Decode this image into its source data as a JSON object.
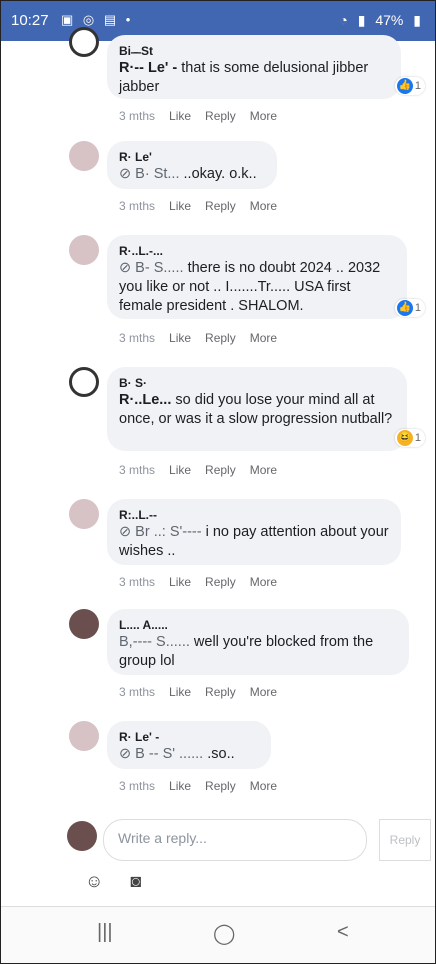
{
  "status_bar": {
    "time": "10:27",
    "left_icons": "▣ ◎ ▤ •",
    "battery": "47%"
  },
  "comments": [
    {
      "name": "Bi ̶  ̶ St",
      "mention": "R·-- Le' -",
      "text": "that is some delusional jibber jabber",
      "time": "3 mths",
      "like": "Like",
      "reply": "Reply",
      "more": "More",
      "reaction": "like",
      "reaction_count": "1"
    },
    {
      "name": "R· Le' ",
      "reply_to": "⊘ B·  St...",
      "text": "..okay. o.k..",
      "time": "3 mths",
      "like": "Like",
      "reply": "Reply",
      "more": "More"
    },
    {
      "name": "R·..L.-...",
      "reply_to": "⊘ B-  S.....",
      "text": "there is no doubt 2024 .. 2032 you like or not .. I.......Tr..... USA first female president . SHALOM.",
      "time": "3 mths",
      "like": "Like",
      "reply": "Reply",
      "more": "More",
      "reaction": "like",
      "reaction_count": "1"
    },
    {
      "name": "B·  S·",
      "mention": "R·..Le...",
      "text": "so did you lose your mind all at once, or was it a slow progression nutball?",
      "time": "3 mths",
      "like": "Like",
      "reply": "Reply",
      "more": "More",
      "reaction": "haha",
      "reaction_count": "1"
    },
    {
      "name": "R:..L.--",
      "reply_to": "⊘ Br ..: S'----",
      "text": "i no pay attention about your wishes ..",
      "time": "3 mths",
      "like": "Like",
      "reply": "Reply",
      "more": "More"
    },
    {
      "name": "L.... A.....",
      "reply_to": "B,---- S......",
      "text": "well you're blocked from the group lol",
      "time": "3 mths",
      "like": "Like",
      "reply": "Reply",
      "more": "More"
    },
    {
      "name": "R· Le' -",
      "reply_to": "⊘ B  -- S' ......",
      "text": ".so..",
      "time": "3 mths",
      "like": "Like",
      "reply": "Reply",
      "more": "More"
    }
  ],
  "composer": {
    "placeholder": "Write a reply...",
    "reply_button": "Reply"
  },
  "nav": {
    "recents": "|||",
    "home": "◯",
    "back": "<"
  }
}
